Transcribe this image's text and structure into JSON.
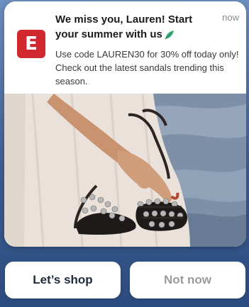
{
  "notification": {
    "app_icon_letter": "E",
    "title": "We miss you, Lauren! Start your summer with us",
    "title_emoji": "leaf-icon",
    "timestamp": "now",
    "message": "Use code LAUREN30 for 30% off today only! Check out the latest sandals trending this season."
  },
  "actions": {
    "primary_label": "Let’s shop",
    "secondary_label": "Not now"
  },
  "colors": {
    "brand_red": "#d0282e",
    "background_blue": "#3e5f93",
    "card_white": "#ffffff"
  }
}
